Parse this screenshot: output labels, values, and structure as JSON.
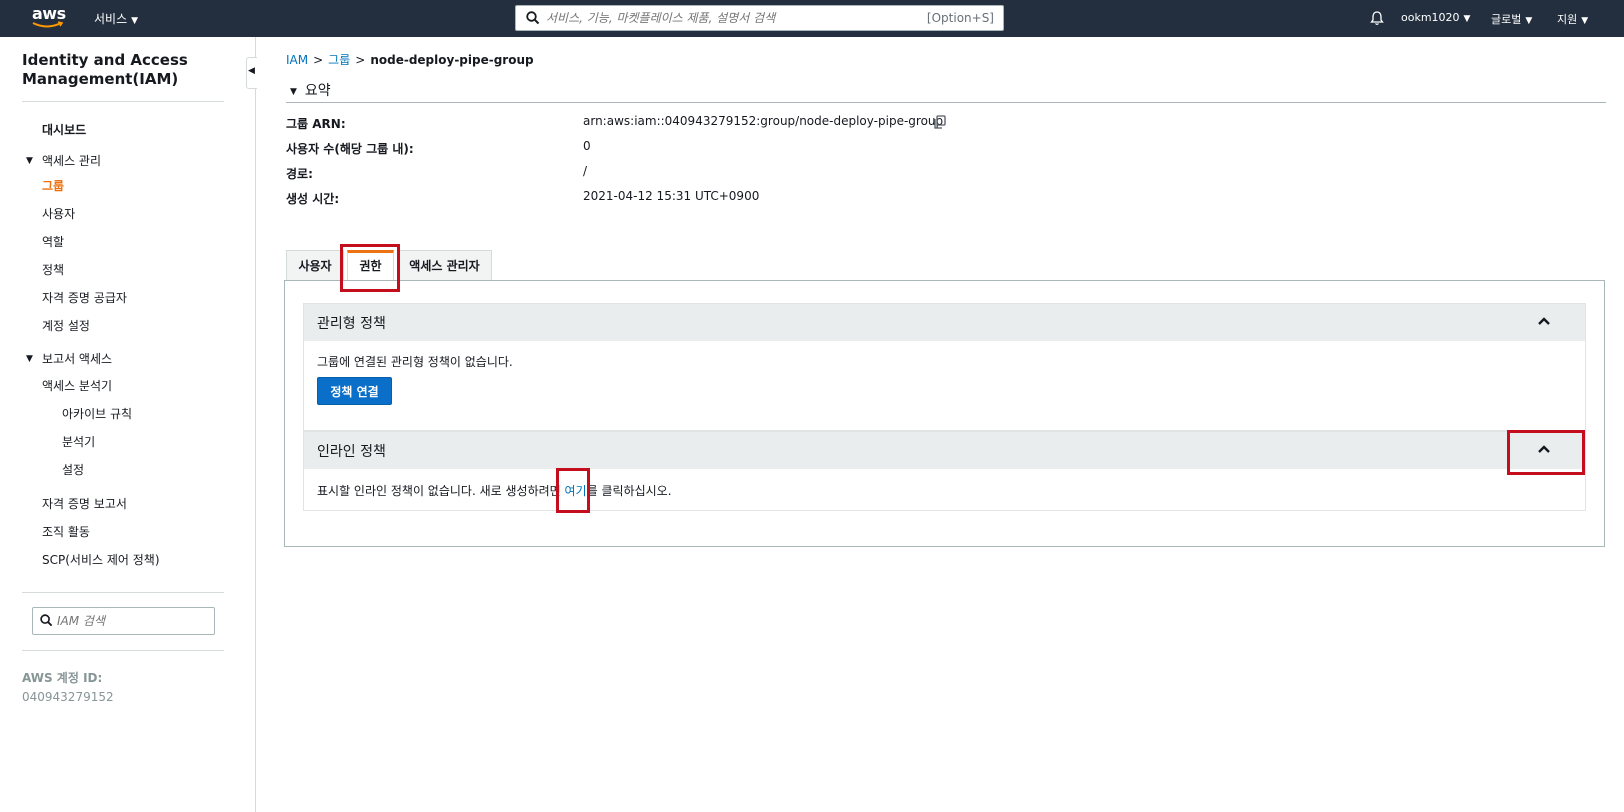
{
  "topnav": {
    "logo_text": "aws",
    "services_label": "서비스",
    "search_placeholder": "서비스, 기능, 마켓플레이스 제품, 설명서 검색",
    "search_shortcut": "[Option+S]",
    "account_label": "ookm1020",
    "region_label": "글로벌",
    "support_label": "지원"
  },
  "sidebar": {
    "title": "Identity and Access Management(IAM)",
    "dashboard": "대시보드",
    "access_mgmt": "액세스 관리",
    "access_items": [
      "그룹",
      "사용자",
      "역할",
      "정책",
      "자격 증명 공급자",
      "계정 설정"
    ],
    "report_access": "보고서 액세스",
    "analyzer": "액세스 분석기",
    "analyzer_items": [
      "아카이브 규칙",
      "분석기",
      "설정"
    ],
    "extra_items": [
      "자격 증명 보고서",
      "조직 활동",
      "SCP(서비스 제어 정책)"
    ],
    "search_placeholder": "IAM 검색",
    "account_id_label": "AWS 계정 ID:",
    "account_id": "040943279152"
  },
  "breadcrumb": {
    "root": "IAM",
    "groups": "그룹",
    "current": "node-deploy-pipe-group"
  },
  "summary": {
    "heading": "요약",
    "rows": [
      {
        "label": "그룹 ARN:",
        "value": "arn:aws:iam::040943279152:group/node-deploy-pipe-group"
      },
      {
        "label": "사용자 수(해당 그룹 내):",
        "value": "0"
      },
      {
        "label": "경로:",
        "value": "/"
      },
      {
        "label": "생성 시간:",
        "value": "2021-04-12 15:31 UTC+0900"
      }
    ]
  },
  "tabs": [
    {
      "label": "사용자",
      "active": false
    },
    {
      "label": "권한",
      "active": true
    },
    {
      "label": "액세스 관리자",
      "active": false
    }
  ],
  "managed": {
    "title": "관리형 정책",
    "empty_text": "그룹에 연결된 관리형 정책이 없습니다.",
    "attach_button": "정책 연결"
  },
  "inline": {
    "title": "인라인 정책",
    "text_before": "표시할 인라인 정책이 없습니다. 새로 생성하려면 ",
    "link_text": "여기",
    "text_after": "를 클릭하십시오."
  },
  "colors": {
    "nav_bg": "#232f3e",
    "accent": "#ec7211",
    "link": "#0073bb",
    "primary_button": "#0a6fc8",
    "highlight_box": "#c40d1d"
  },
  "icons": [
    "aws-logo",
    "search-icon",
    "bell-icon",
    "caret-down-icon",
    "copy-icon",
    "chevron-up-icon",
    "collapse-left-icon"
  ]
}
